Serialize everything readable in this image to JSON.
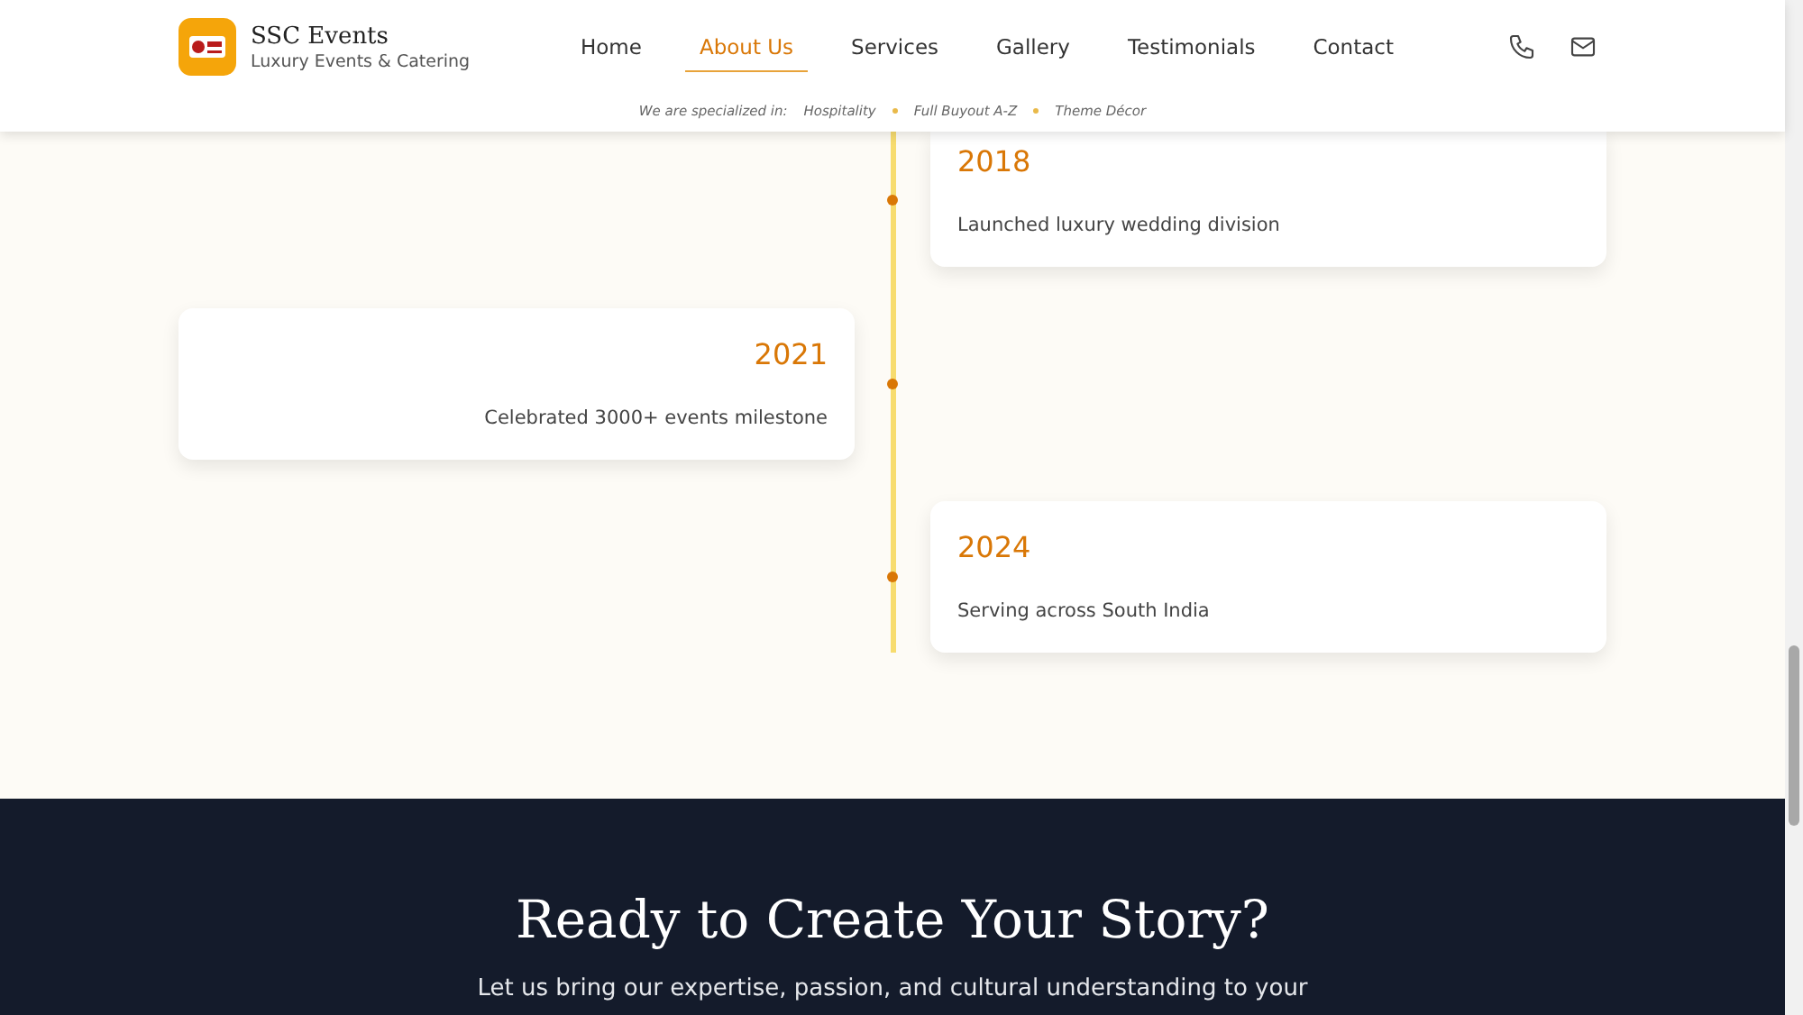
{
  "header": {
    "brand": "SSC Events",
    "tagline": "Luxury Events & Catering",
    "nav": [
      {
        "label": "Home",
        "selected": false
      },
      {
        "label": "About Us",
        "selected": true
      },
      {
        "label": "Services",
        "selected": false
      },
      {
        "label": "Gallery",
        "selected": false
      },
      {
        "label": "Testimonials",
        "selected": false
      },
      {
        "label": "Contact",
        "selected": false
      }
    ],
    "specialized": {
      "label": "We are specialized in:",
      "items": [
        "Hospitality",
        "Full Buyout A-Z",
        "Theme Décor"
      ]
    }
  },
  "timeline": [
    {
      "year": "2018",
      "text": "Launched luxury wedding division",
      "kind": "right"
    },
    {
      "year": "2021",
      "text": "Celebrated 3000+ events milestone",
      "kind": "left"
    },
    {
      "year": "2024",
      "text": "Serving across South India",
      "kind": "right"
    }
  ],
  "cta": {
    "title": "Ready to Create Your Story?",
    "text": "Let us bring our expertise, passion, and cultural understanding to your"
  }
}
